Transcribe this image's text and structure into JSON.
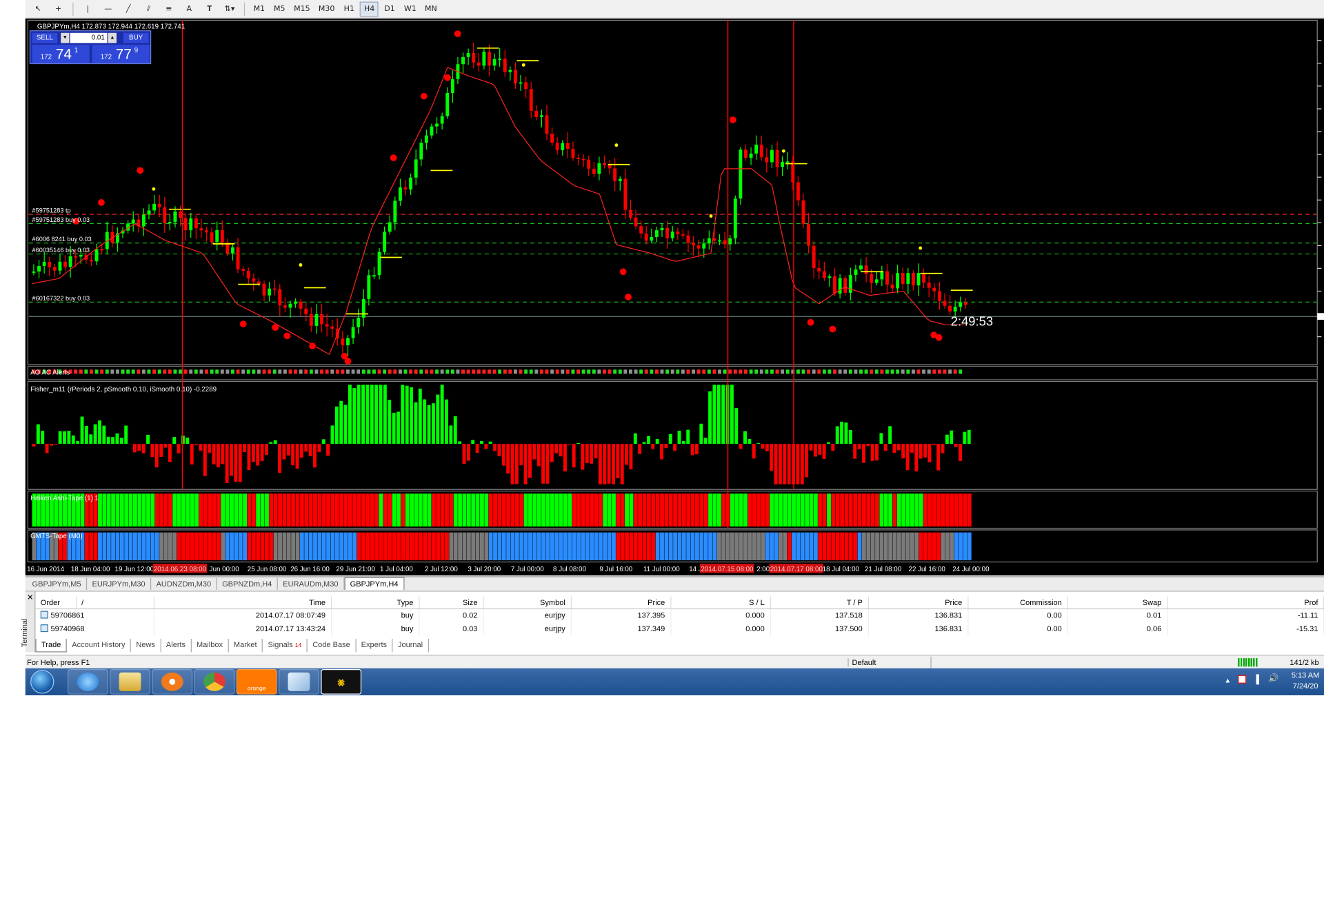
{
  "toolbar": {
    "timeframes": [
      "M1",
      "M5",
      "M15",
      "M30",
      "H1",
      "H4",
      "D1",
      "W1",
      "MN"
    ],
    "active_timeframe": "H4"
  },
  "chart": {
    "header": "GBPJPYm,H4  172.873 172.944 172.619 172.741",
    "trade_panel": {
      "sell_label": "SELL",
      "buy_label": "BUY",
      "lot": "0.01",
      "sell_price_prefix": "172",
      "sell_price_big": "74",
      "sell_price_sup": "1",
      "buy_price_prefix": "172",
      "buy_price_big": "77",
      "buy_price_sup": "9"
    },
    "order_lines": [
      "#59751283 tp",
      "#59751283 buy 0.03",
      "#6006 8241 buy 0.03",
      "#60035146 buy 0.03",
      "#60167322 buy 0.03"
    ],
    "countdown": "2:49:53",
    "indicator_alerts_label": "AO AC Alerts",
    "fisher_label": "Fisher_m11  (rPeriods 2, pSmooth 0.10, iSmooth 0.10)   -0.2289",
    "heiken_label": "Heiken Ashi-Tape (1) 1",
    "gmts_label": "GMTS-Tape (M0)",
    "x_axis": [
      "16 Jun 2014",
      "18 Jun 04:00",
      "19 Jun 12:00",
      "2014.06.23 08:00",
      "Jun 00:00",
      "25 Jun 08:00",
      "26 Jun 16:00",
      "29 Jun 21:00",
      "1 Jul 04:00",
      "2 Jul 12:00",
      "3 Jul 20:00",
      "7 Jul 00:00",
      "8 Jul 08:00",
      "9 Jul 16:00",
      "11 Jul 00:00",
      "14 J",
      "2014.07.15 08:00",
      "2:00",
      "2014.07.17 08:00",
      "18 Jul 04:00",
      "21 Jul 08:00",
      "22 Jul 16:00",
      "24 Jul 00:00"
    ],
    "colors": {
      "bull": "#00ff00",
      "bear": "#ff0000",
      "ma": "#ff2020",
      "hline": "#ffff00",
      "gmts_blue": "#2a8cff",
      "gmts_gray": "#7a7a7a"
    }
  },
  "chart_tabs": [
    "GBPJPYm,M5",
    "EURJPYm,M30",
    "AUDNZDm,M30",
    "GBPNZDm,H4",
    "EURAUDm,M30",
    "GBPJPYm,H4"
  ],
  "active_chart_tab": "GBPJPYm,H4",
  "terminal": {
    "side_label": "Terminal",
    "columns": [
      "Order",
      "/",
      "Time",
      "Type",
      "Size",
      "Symbol",
      "Price",
      "S / L",
      "T / P",
      "Price",
      "Commission",
      "Swap",
      "Prof"
    ],
    "rows": [
      {
        "order": "59706861",
        "time": "2014.07.17 08:07:49",
        "type": "buy",
        "size": "0.02",
        "symbol": "eurjpy",
        "price": "137.395",
        "sl": "0.000",
        "tp": "137.518",
        "cur": "136.831",
        "commission": "0.00",
        "swap": "0.01",
        "profit": "-11.11"
      },
      {
        "order": "59740968",
        "time": "2014.07.17 13:43:24",
        "type": "buy",
        "size": "0.03",
        "symbol": "eurjpy",
        "price": "137.349",
        "sl": "0.000",
        "tp": "137.500",
        "cur": "136.831",
        "commission": "0.00",
        "swap": "0.06",
        "profit": "-15.31"
      }
    ],
    "tabs": [
      "Trade",
      "Account History",
      "News",
      "Alerts",
      "Mailbox",
      "Market",
      "Signals",
      "Code Base",
      "Experts",
      "Journal"
    ],
    "signals_badge": "14",
    "active_tab": "Trade"
  },
  "statusbar": {
    "help": "For Help, press F1",
    "profile": "Default",
    "traffic": "141/2 kb"
  },
  "taskbar": {
    "time": "5:13 AM",
    "date": "7/24/20",
    "orange_label": "orange"
  }
}
